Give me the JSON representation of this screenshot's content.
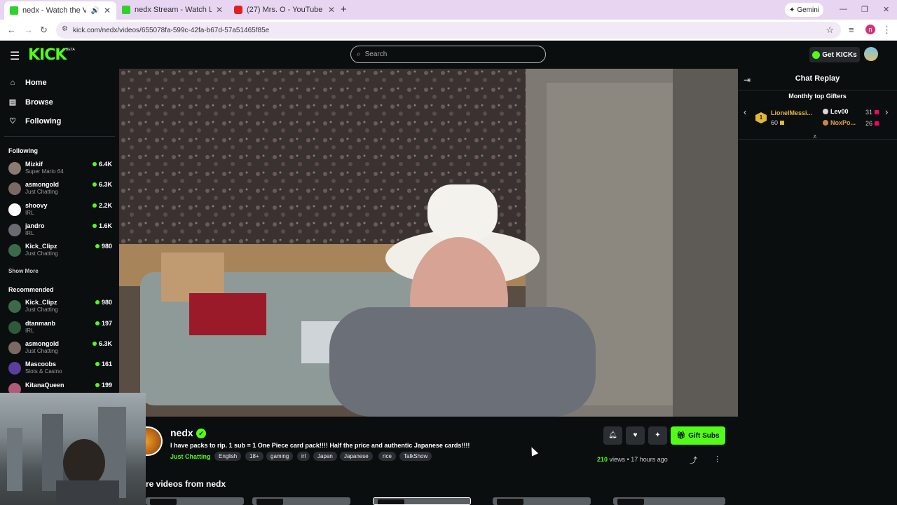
{
  "browser": {
    "tabs": [
      {
        "title": "nedx - Watch the VOD on Kick",
        "active": true
      },
      {
        "title": "nedx Stream - Watch Live on Kick",
        "active": false
      },
      {
        "title": "(27) Mrs. O - YouTube",
        "active": false
      }
    ],
    "new_tab": "+",
    "gemini_label": "Gemini",
    "url": "kick.com/nedx/videos/655078fa-599c-42fa-b67d-57a51465f85e",
    "profile_initial": "n"
  },
  "header": {
    "logo": "KICK",
    "logo_badge": "BETA",
    "search_placeholder": "Search",
    "get_kicks_label": "Get KICKs"
  },
  "sidebar": {
    "nav": [
      {
        "label": "Home",
        "icon": "home-icon"
      },
      {
        "label": "Browse",
        "icon": "browse-icon"
      },
      {
        "label": "Following",
        "icon": "heart-icon"
      }
    ],
    "following_title": "Following",
    "following": [
      {
        "name": "Mizkif",
        "category": "Super Mario 64",
        "viewers": "6.4K"
      },
      {
        "name": "asmongold",
        "category": "Just Chatting",
        "viewers": "6.3K"
      },
      {
        "name": "shoovy",
        "category": "IRL",
        "viewers": "2.2K"
      },
      {
        "name": "jandro",
        "category": "IRL",
        "viewers": "1.6K"
      },
      {
        "name": "Kick_Clipz",
        "category": "Just Chatting",
        "viewers": "980"
      }
    ],
    "show_more": "Show More",
    "recommended_title": "Recommended",
    "recommended": [
      {
        "name": "Kick_Clipz",
        "category": "Just Chatting",
        "viewers": "980"
      },
      {
        "name": "dtanmanb",
        "category": "IRL",
        "viewers": "197"
      },
      {
        "name": "asmongold",
        "category": "Just Chatting",
        "viewers": "6.3K"
      },
      {
        "name": "Mascoobs",
        "category": "Slots & Casino",
        "viewers": "161"
      },
      {
        "name": "KitanaQueen",
        "category": "",
        "viewers": "199"
      }
    ]
  },
  "chat": {
    "title": "Chat Replay",
    "gifters_title": "Monthly top Gifters",
    "top_gifter": {
      "rank": "1",
      "name": "LionelMessi...",
      "count": "60"
    },
    "gifters": [
      {
        "name": "Lev00",
        "count": "31"
      },
      {
        "name": "NoxPo...",
        "count": "26"
      }
    ]
  },
  "stream": {
    "name": "nedx",
    "title": "I have packs to rip. 1 sub = 1 One Piece card pack!!!! Half the price and authentic Japanese cards!!!!",
    "category": "Just Chatting",
    "tags": [
      "English",
      "18+",
      "gaming",
      "irl",
      "Japan",
      "Japanese",
      "rice",
      "TalkShow"
    ],
    "gift_subs_label": "Gift Subs",
    "views_count": "210",
    "views_label": "views",
    "separator": "•",
    "time_ago": "17 hours ago",
    "more_videos_title": "re videos from nedx"
  }
}
